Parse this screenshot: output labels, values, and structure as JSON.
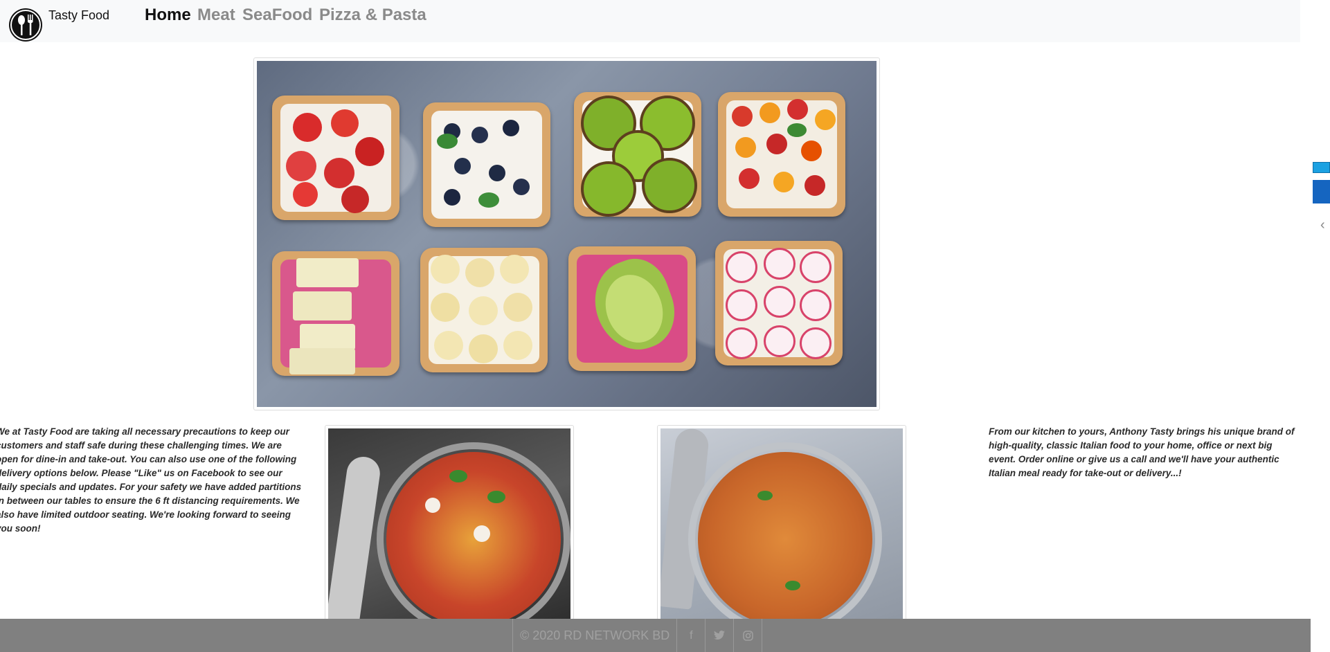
{
  "brand": {
    "name": "Tasty Food",
    "logo_icon": "cutlery-icon"
  },
  "nav": {
    "items": [
      {
        "label": "Home",
        "active": true
      },
      {
        "label": "Meat",
        "active": false
      },
      {
        "label": "SeaFood",
        "active": false
      },
      {
        "label": "Pizza & Pasta",
        "active": false
      }
    ]
  },
  "content": {
    "left_text": "We at Tasty Food are taking all necessary precautions to keep our customers and staff safe during these challenging times. We are open for dine-in and take-out. You can also use one of the following delivery options below. Please \"Like\" us on Facebook to see our daily specials and updates. For your safety we have added partitions in between our tables to ensure the 6 ft distancing requirements. We also have limited outdoor seating. We're looking forward to seeing you soon!",
    "right_text": "From our kitchen to yours, Anthony Tasty brings his unique brand of high-quality, classic Italian food to your home, office or next big event. Order online or give us a call and we'll have your authentic Italian meal ready for take-out or delivery...!"
  },
  "footer": {
    "copyright": "© 2020 RD NETWORK BD",
    "social": [
      {
        "icon": "facebook-icon",
        "glyph": "f"
      },
      {
        "icon": "twitter-icon",
        "glyph": "🐦"
      },
      {
        "icon": "instagram-icon",
        "glyph": "◎"
      }
    ]
  },
  "colors": {
    "navbar_bg": "#f8f9fa",
    "active_link": "#111111",
    "inactive_link": "#8a8a8a",
    "footer_bg": "#808080"
  }
}
